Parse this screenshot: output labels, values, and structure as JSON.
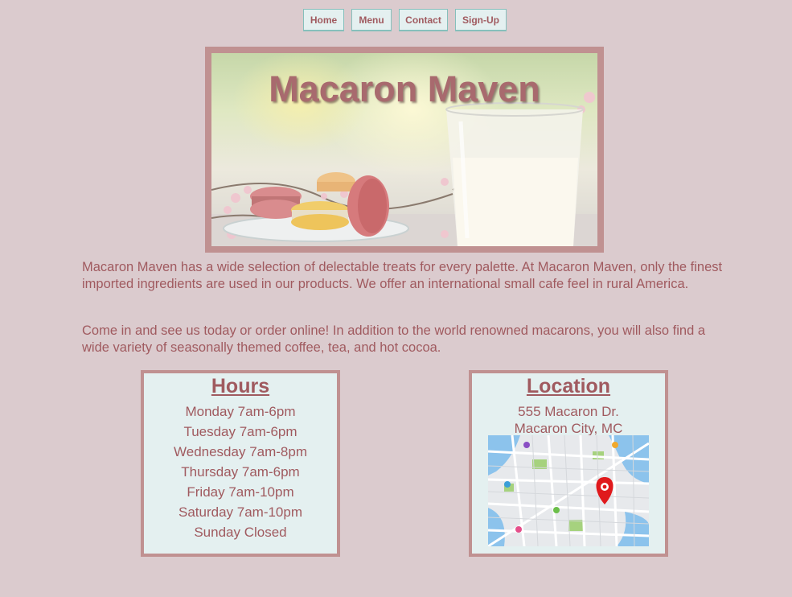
{
  "nav": {
    "items": [
      {
        "label": "Home"
      },
      {
        "label": "Menu"
      },
      {
        "label": "Contact"
      },
      {
        "label": "Sign-Up"
      }
    ]
  },
  "hero": {
    "title": "Macaron Maven"
  },
  "intro": {
    "paragraph1": "Macaron Maven has a wide selection of delectable treats for every palette. At Macaron Maven, only the finest imported ingredients are used in our products. We offer an international small cafe feel in rural America.",
    "paragraph2": "Come in and see us today or order online! In addition to the world renowned macarons, you will also find a wide variety of seasonally themed coffee, tea, and hot cocoa."
  },
  "hours": {
    "heading": "Hours",
    "days": [
      "Monday 7am-6pm",
      "Tuesday 7am-6pm",
      "Wednesday 7am-8pm",
      "Thursday 7am-6pm",
      "Friday 7am-10pm",
      "Saturday 7am-10pm",
      "Sunday Closed"
    ]
  },
  "location": {
    "heading": "Location",
    "street": "555 Macaron Dr.",
    "city": "Macaron City, MC"
  },
  "colors": {
    "background": "#dbcbce",
    "text": "#a05a5f",
    "border": "#c09191",
    "card": "#e4f0f0",
    "nav_border": "#86c0bc"
  }
}
